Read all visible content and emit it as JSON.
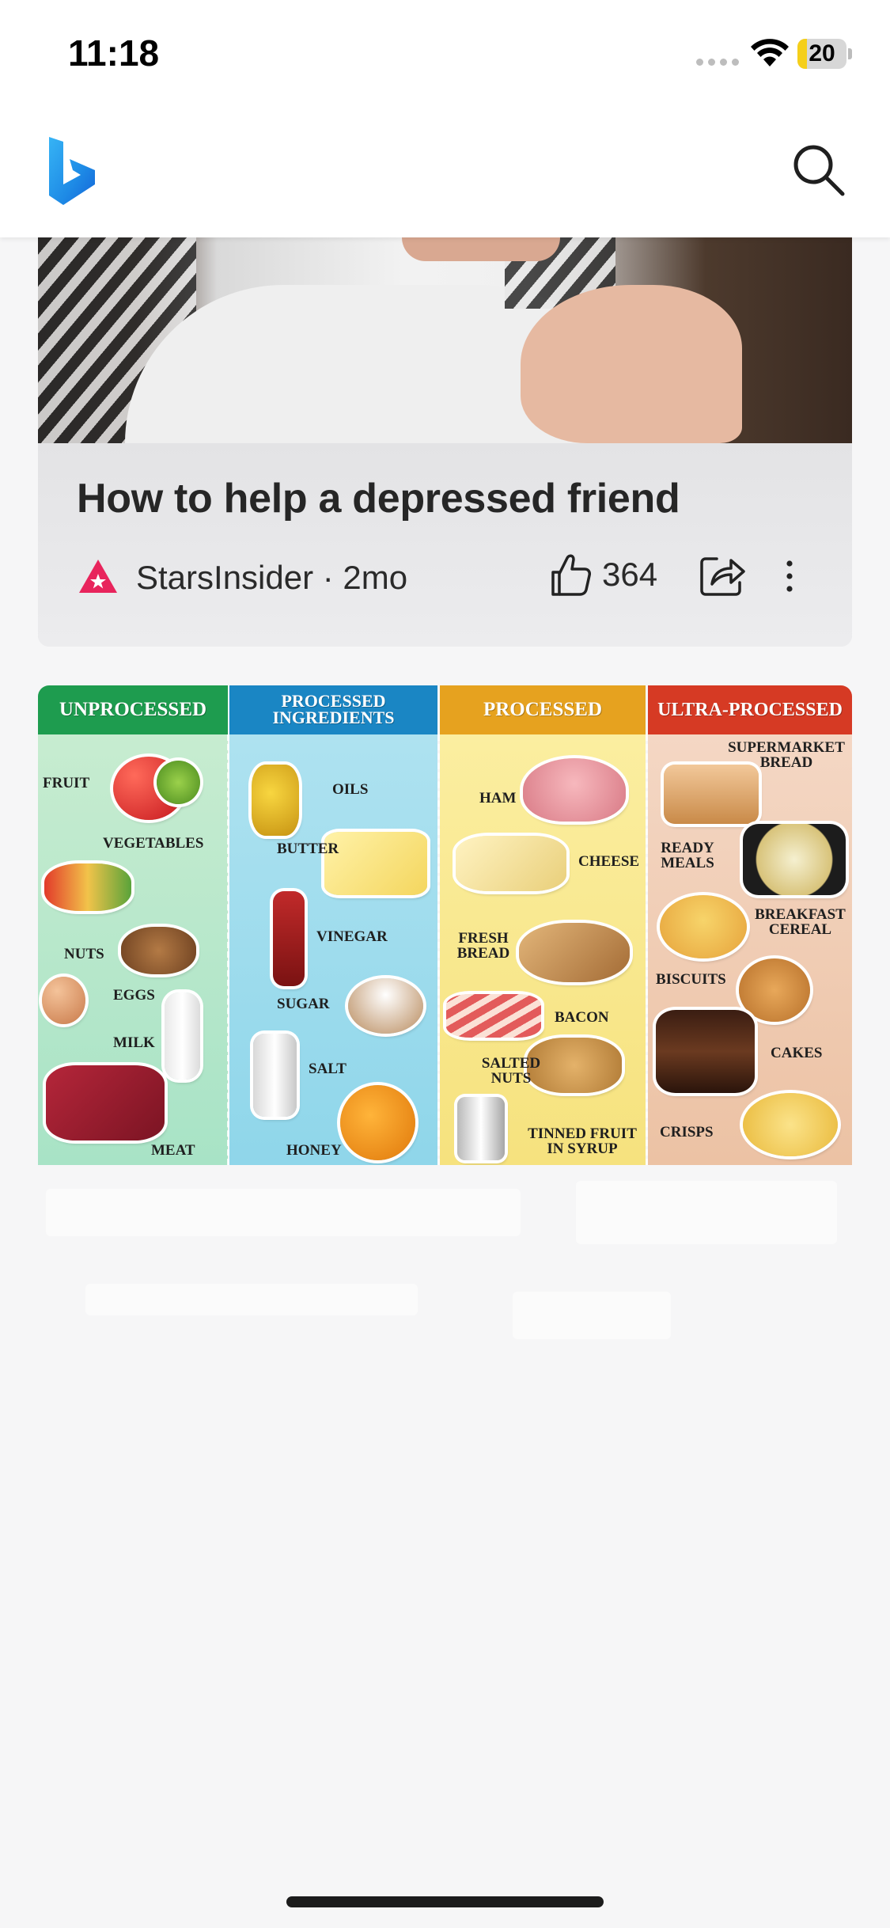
{
  "status_bar": {
    "time": "11:18",
    "battery_level": "20",
    "battery_fraction": 0.2,
    "battery_color": "#f5cf1a",
    "icons": [
      "signal-icon",
      "wifi-icon",
      "battery-icon"
    ]
  },
  "header": {
    "logo": "bing-logo",
    "search_icon": "search-icon",
    "logo_color_top": "#2a9df4",
    "logo_color_bottom": "#1a6ee0"
  },
  "feed": {
    "card_one": {
      "title": "How to help a depressed friend",
      "source": "StarsInsider · 2mo",
      "source_logo_color": "#e8245c",
      "likes": "364",
      "like_icon": "thumbs-up-icon",
      "share_icon": "share-icon",
      "more_icon": "more-vertical-icon"
    },
    "card_two": {
      "image": "food-processing-infographic",
      "columns": [
        {
          "header": "UNPROCESSED",
          "header_color": "#1e9c4f",
          "items": [
            "FRUIT",
            "VEGETABLES",
            "NUTS",
            "EGGS",
            "MILK",
            "MEAT"
          ]
        },
        {
          "header": "PROCESSED INGREDIENTS",
          "header_color": "#1a86c4",
          "items": [
            "OILS",
            "BUTTER",
            "VINEGAR",
            "SUGAR",
            "SALT",
            "HONEY"
          ]
        },
        {
          "header": "PROCESSED",
          "header_color": "#e6a21f",
          "items": [
            "HAM",
            "CHEESE",
            "FRESH BREAD",
            "BACON",
            "SALTED NUTS",
            "TINNED FRUIT IN SYRUP"
          ]
        },
        {
          "header": "ULTRA-PROCESSED",
          "header_color": "#d63a24",
          "items": [
            "SUPERMARKET BREAD",
            "READY MEALS",
            "BREAKFAST CEREAL",
            "BISCUITS",
            "CAKES",
            "CRISPS"
          ]
        }
      ]
    }
  }
}
